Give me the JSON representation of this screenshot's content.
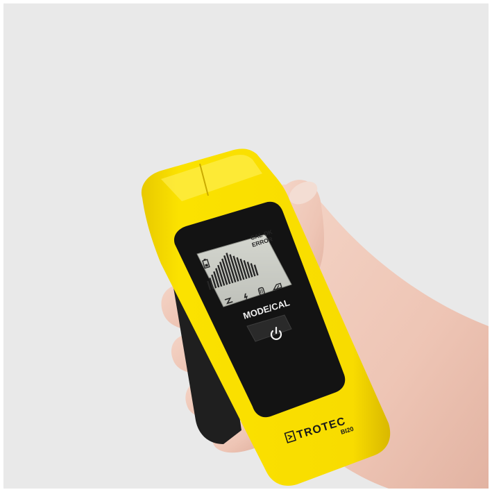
{
  "device": {
    "brand": "TROTEC",
    "model": "BI20",
    "button_label": "MODE/CAL",
    "display": {
      "status_line_1": "CAL OK",
      "status_line_2": "ERROR",
      "bar_levels": [
        0.3,
        0.38,
        0.46,
        0.54,
        0.62,
        0.7,
        0.78,
        0.86,
        0.94,
        1.0,
        0.92,
        0.84,
        0.76,
        0.68,
        0.6,
        0.52,
        0.44,
        0.36
      ],
      "bottom_icons": [
        "wood-icon",
        "live-wire-icon",
        "metal-icon",
        "depth-icon"
      ],
      "top_icon": "battery-icon"
    },
    "power_icon": "power-icon",
    "colors": {
      "body": "#f7de00",
      "face": "#131313",
      "lcd": "#c9cbc4",
      "background": "#e9e9e9"
    }
  }
}
